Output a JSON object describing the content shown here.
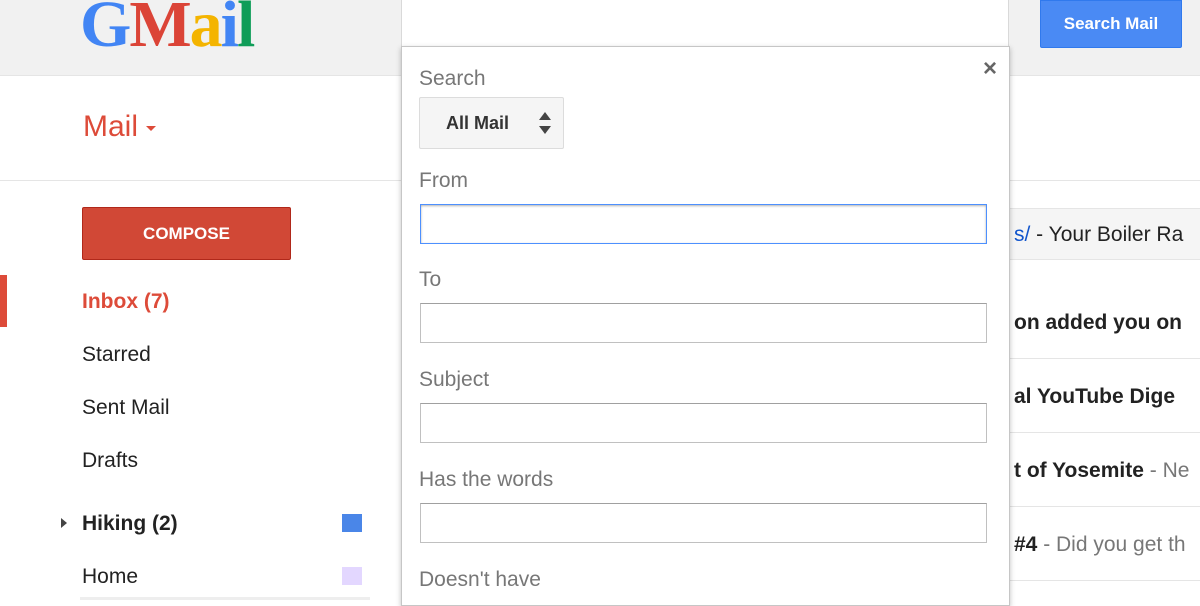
{
  "header": {
    "logo_letters": [
      "G",
      "M",
      "a",
      "i",
      "l"
    ],
    "search_button": "Search Mail"
  },
  "app_switcher": {
    "label": "Mail"
  },
  "sidebar": {
    "compose_label": "COMPOSE",
    "items": [
      {
        "label": "Inbox (7)",
        "active": true
      },
      {
        "label": "Starred"
      },
      {
        "label": "Sent Mail"
      },
      {
        "label": "Drafts"
      },
      {
        "label": "Hiking (2)",
        "color": "#4a86e8",
        "expandable": true
      },
      {
        "label": "Home",
        "color": "#e3d7ff"
      }
    ]
  },
  "search_panel": {
    "search_label": "Search",
    "search_in_value": "All Mail",
    "from_label": "From",
    "from_value": "",
    "to_label": "To",
    "to_value": "",
    "subject_label": "Subject",
    "subject_value": "",
    "has_words_label": "Has the words",
    "has_words_value": "",
    "doesnt_have_label": "Doesn't have"
  },
  "message_list": {
    "header_link": "s/",
    "header_text": " - Your Boiler Ra",
    "rows": [
      {
        "bold": "on added you on",
        "rest": ""
      },
      {
        "bold": "al YouTube Dige",
        "rest": ""
      },
      {
        "bold": "t of Yosemite",
        "rest": " - Ne"
      },
      {
        "bold": "#4",
        "rest": " - Did you get th"
      }
    ]
  },
  "colors": {
    "accent_red": "#dd4b39",
    "compose_red": "#d14836",
    "search_blue": "#4a8af4",
    "link_blue": "#1155cc"
  }
}
